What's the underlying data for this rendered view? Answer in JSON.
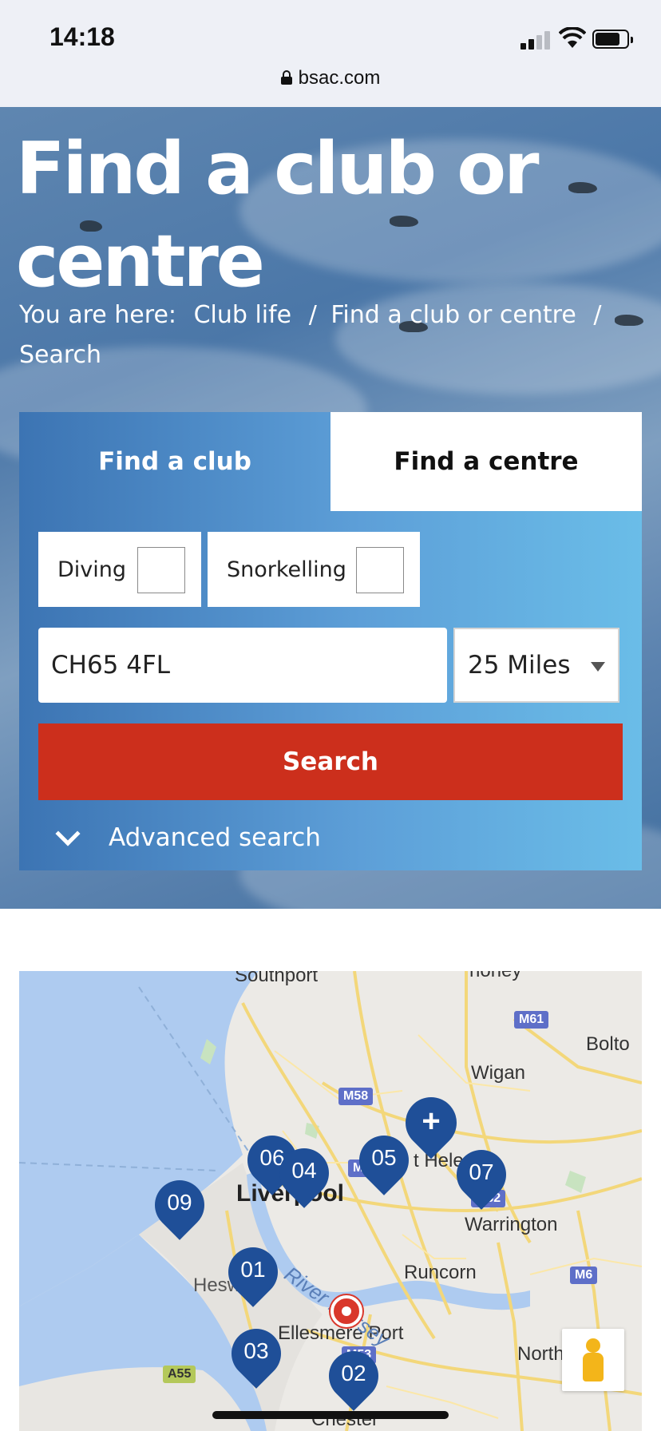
{
  "status_bar": {
    "time": "14:18",
    "url": "bsac.com"
  },
  "hero": {
    "title": "Find a club or centre",
    "breadcrumb": {
      "prefix": "You are here:",
      "items": [
        "Club life",
        "Find a club or centre",
        "Search"
      ],
      "separator": "/"
    }
  },
  "search": {
    "tabs": [
      "Find a club",
      "Find a centre"
    ],
    "active_tab": "Find a club",
    "filters": [
      {
        "label": "Diving",
        "checked": false
      },
      {
        "label": "Snorkelling",
        "checked": false
      }
    ],
    "postcode_value": "CH65 4FL",
    "distance_value": "25 Miles",
    "search_label": "Search",
    "advanced_label": "Advanced search"
  },
  "map": {
    "places": [
      "Southport",
      "Wigan",
      "Bolton",
      "Liverpool",
      "Warrington",
      "Runcorn",
      "Heswall",
      "Ellesmere Port",
      "Northwich",
      "Chester",
      "St Helens",
      "Chorley"
    ],
    "visible_place_text": [
      "Southport",
      "Wigan",
      "Bolto",
      "Liverpool",
      "Warrington",
      "Runcorn",
      "Hesw",
      "Ellesmere Port",
      "North",
      "Chester",
      "t Hele",
      "horley"
    ],
    "roads": [
      "M61",
      "M58",
      "M5",
      "M62",
      "M6",
      "A55",
      "M53"
    ],
    "river": "River Mersey",
    "pins": [
      "01",
      "02",
      "03",
      "04",
      "05",
      "06",
      "07",
      "09"
    ],
    "cluster_label": "+"
  },
  "colors": {
    "accent_red": "#cc2f1c",
    "panel_blue": "#3c74b3",
    "pin_blue": "#1f4f98"
  }
}
